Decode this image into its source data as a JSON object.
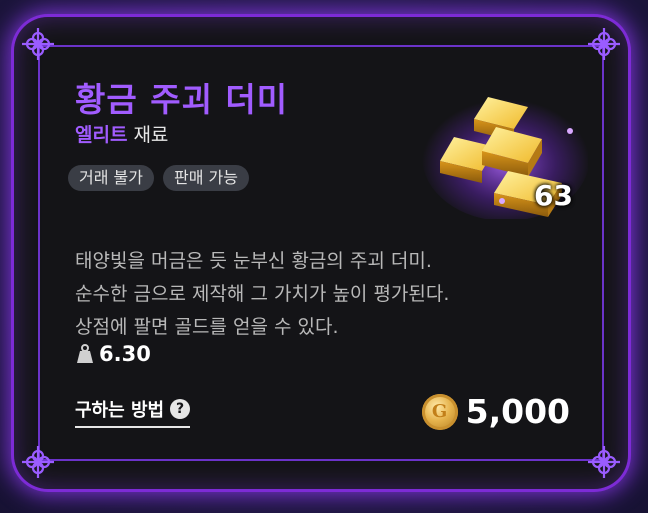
{
  "item": {
    "name": "황금 주괴 더미",
    "grade": "엘리트",
    "category": "재료",
    "tags": [
      "거래 불가",
      "판매 가능"
    ],
    "quantity": "63",
    "description": [
      "태양빛을 머금은 듯 눈부신 황금의 주괴 더미.",
      "순수한 금으로 제작해 그 가치가 높이 평가된다.",
      "상점에 팔면 골드를 얻을 수 있다."
    ],
    "weight": "6.30",
    "how_to_obtain": "구하는 방법",
    "help_glyph": "?",
    "price": "5,000",
    "coin_glyph": "G"
  },
  "colors": {
    "accent": "#a15cff",
    "frame": "#7d2bd6",
    "card_bg": "#141417",
    "tag_bg": "#3a3d45",
    "gold": "#e6b34c"
  },
  "icons": {
    "weight": "weight-icon",
    "help": "question-circle-icon",
    "coin": "gold-coin-icon",
    "item": "gold-ingots-icon",
    "corner": "ornament-corner-icon"
  }
}
